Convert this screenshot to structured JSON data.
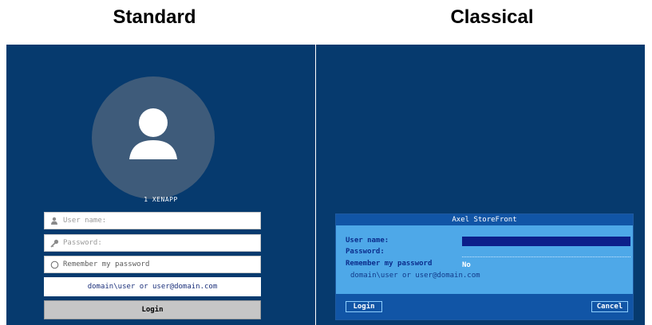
{
  "standard": {
    "title": "Standard",
    "server_name": "1 XENAPP",
    "user_placeholder": "User name:",
    "password_placeholder": "Password:",
    "remember_label": "Remember my password",
    "hint": "domain\\user or user@domain.com",
    "login_label": "Login",
    "icons": [
      "user-icon",
      "key-icon",
      "radio-icon",
      "avatar-icon"
    ]
  },
  "classical": {
    "title": "Classical",
    "dialog_title": "Axel StoreFront",
    "user_label": "User name:",
    "password_label": "Password:",
    "remember_label": "Remember my password",
    "remember_value": "No",
    "hint": "domain\\user or user@domain.com",
    "login_label": "Login",
    "cancel_label": "Cancel"
  },
  "colors": {
    "panel_bg": "#063a6e",
    "avatar_circle": "#3e5b7a",
    "dialog_bg": "#4ea8e8",
    "dialog_bar": "#1155a6",
    "input_fill": "#0c1f8a"
  }
}
